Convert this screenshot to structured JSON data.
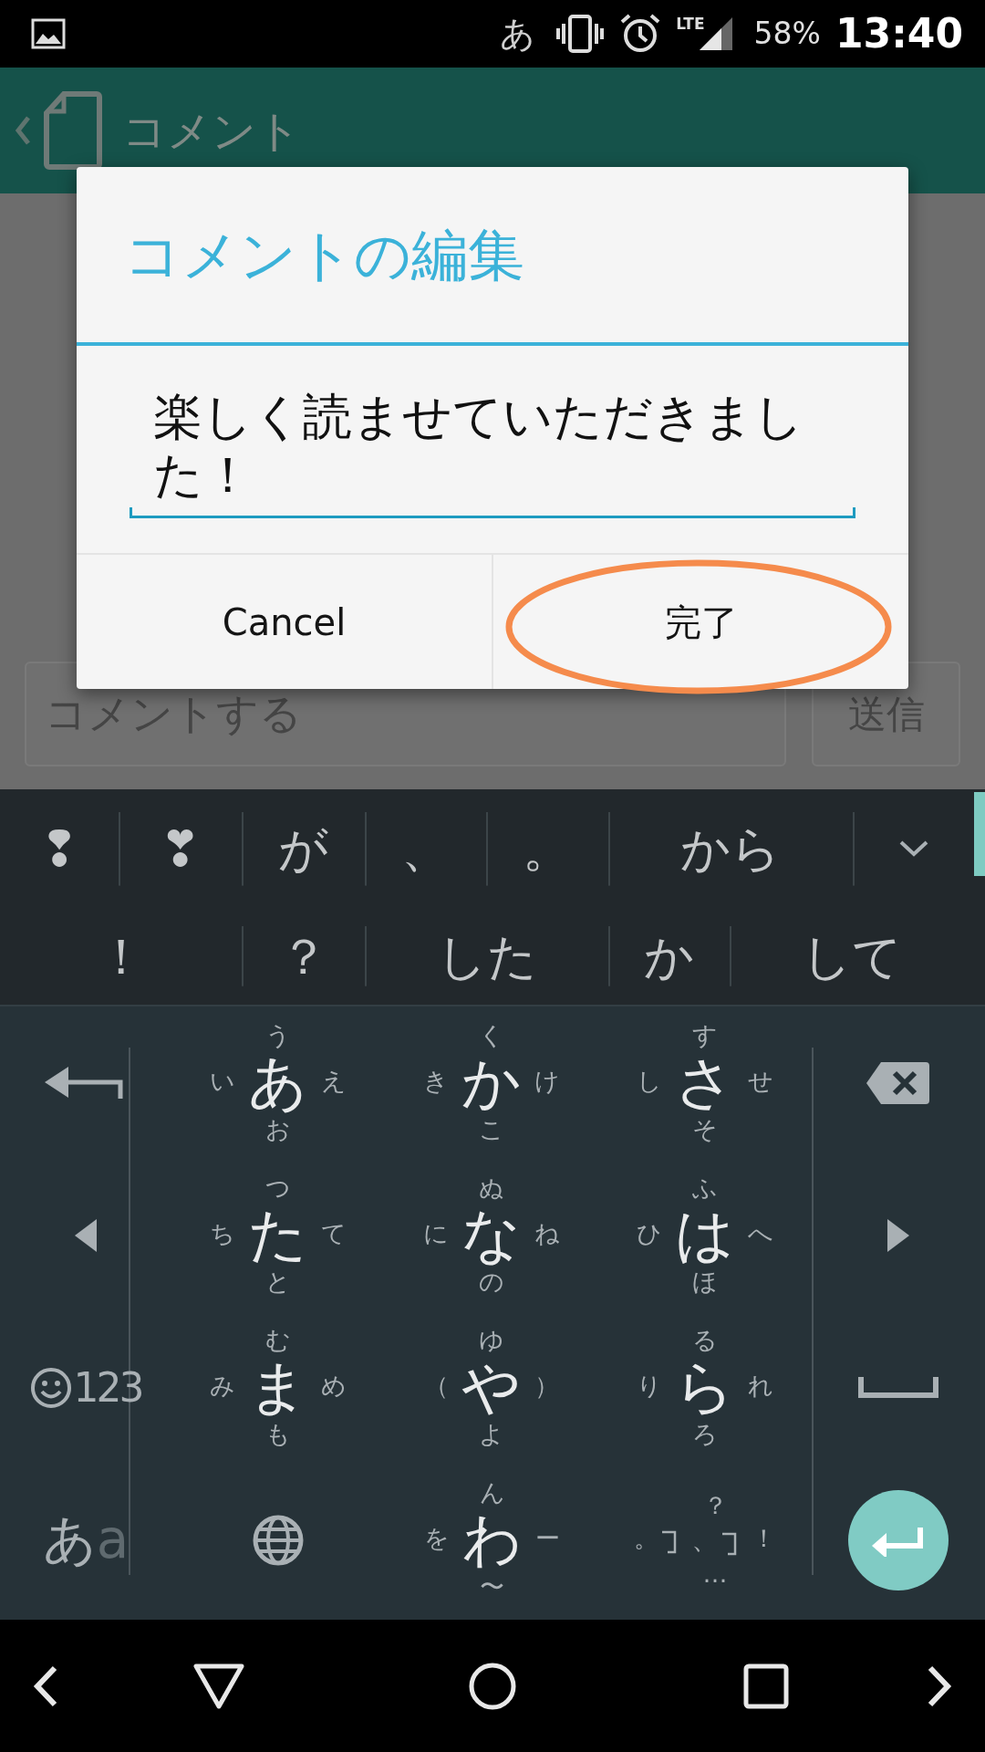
{
  "status_bar": {
    "ime": "あ",
    "network": "LTE",
    "battery": "58%",
    "time": "13:40"
  },
  "app_bar": {
    "title": "コメント"
  },
  "comment_bar": {
    "placeholder": "コメントする",
    "send": "送信"
  },
  "dialog": {
    "title": "コメントの編集",
    "text": "楽しく読ませていただきました！",
    "buttons": [
      {
        "label": "Cancel",
        "circled": false
      },
      {
        "label": "完了",
        "circled": true
      }
    ]
  },
  "keyboard": {
    "candidates": [
      [
        "❢",
        "❣",
        "が",
        "、",
        "。",
        "から"
      ],
      [
        "！",
        "？",
        "した",
        "か",
        "して"
      ]
    ],
    "rows": [
      {
        "left": {
          "kind": "undo"
        },
        "keys": [
          {
            "kind": "flick",
            "center": "あ",
            "up": "う",
            "left": "い",
            "right": "え",
            "down": "お"
          },
          {
            "kind": "flick",
            "center": "か",
            "up": "く",
            "left": "き",
            "right": "け",
            "down": "こ"
          },
          {
            "kind": "flick",
            "center": "さ",
            "up": "す",
            "left": "し",
            "right": "せ",
            "down": "そ"
          }
        ],
        "right": {
          "kind": "backspace"
        }
      },
      {
        "left": {
          "kind": "cursor-left"
        },
        "keys": [
          {
            "kind": "flick",
            "center": "た",
            "up": "つ",
            "left": "ち",
            "right": "て",
            "down": "と"
          },
          {
            "kind": "flick",
            "center": "な",
            "up": "ぬ",
            "left": "に",
            "right": "ね",
            "down": "の"
          },
          {
            "kind": "flick",
            "center": "は",
            "up": "ふ",
            "left": "ひ",
            "right": "へ",
            "down": "ほ"
          }
        ],
        "right": {
          "kind": "cursor-right"
        }
      },
      {
        "left": {
          "kind": "symbols",
          "label": "123"
        },
        "keys": [
          {
            "kind": "flick",
            "center": "ま",
            "up": "む",
            "left": "み",
            "right": "め",
            "down": "も"
          },
          {
            "kind": "flick",
            "center": "や",
            "up": "ゆ",
            "left": "（",
            "right": "）",
            "down": "よ"
          },
          {
            "kind": "flick",
            "center": "ら",
            "up": "る",
            "left": "り",
            "right": "れ",
            "down": "ろ"
          }
        ],
        "right": {
          "kind": "space"
        }
      },
      {
        "left": {
          "kind": "mode",
          "labels": [
            {
              "text": "あ",
              "active": true
            },
            {
              "text": "a",
              "active": false
            }
          ]
        },
        "keys": [
          {
            "kind": "globe"
          },
          {
            "kind": "flick",
            "center": "わ",
            "up": "ん",
            "left": "を",
            "right": "ー",
            "down": "〜"
          },
          {
            "kind": "punct",
            "center": "、",
            "up": "？",
            "left": "。",
            "right": "！",
            "down": "…"
          }
        ],
        "right": {
          "kind": "enter"
        }
      }
    ]
  }
}
